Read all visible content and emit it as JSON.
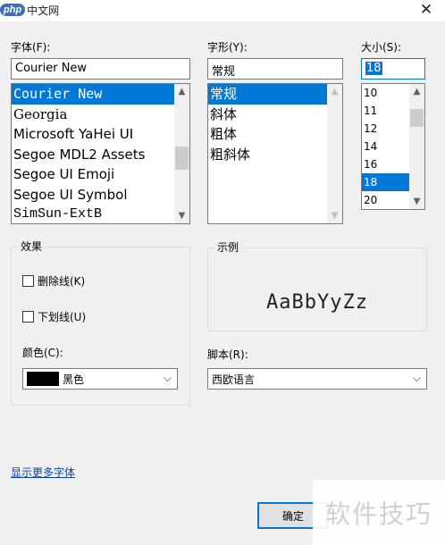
{
  "titlebar": {
    "logo_badge": "php",
    "logo_text": "中文网",
    "close_glyph": "✕"
  },
  "font": {
    "label": "字体(F):",
    "value": "Courier New",
    "items": [
      "Courier New",
      "Georgia",
      "Microsoft YaHei UI",
      "Segoe MDL2 Assets",
      "Segoe UI Emoji",
      "Segoe UI Symbol",
      "SimSun-ExtB"
    ],
    "selected_index": 0
  },
  "style": {
    "label": "字形(Y):",
    "value": "常规",
    "items": [
      "常规",
      "斜体",
      "粗体",
      "粗斜体"
    ],
    "selected_index": 0
  },
  "size": {
    "label": "大小(S):",
    "value": "18",
    "items": [
      "10",
      "11",
      "12",
      "14",
      "16",
      "18",
      "20"
    ],
    "selected_index": 5
  },
  "effects": {
    "title": "效果",
    "strikeout": "删除线(K)",
    "underline": "下划线(U)",
    "color_label": "颜色(C):",
    "color_value": "黑色",
    "color_swatch": "#000000"
  },
  "sample": {
    "title": "示例",
    "text": "AaBbYyZz"
  },
  "script": {
    "label": "脚本(R):",
    "value": "西欧语言"
  },
  "more_fonts_link": "显示更多字体",
  "ok_button": "确定",
  "watermark": "软件技巧",
  "colors": {
    "accent": "#0078d7",
    "dialog_bg": "#f0f0f0",
    "link": "#0645ad"
  }
}
